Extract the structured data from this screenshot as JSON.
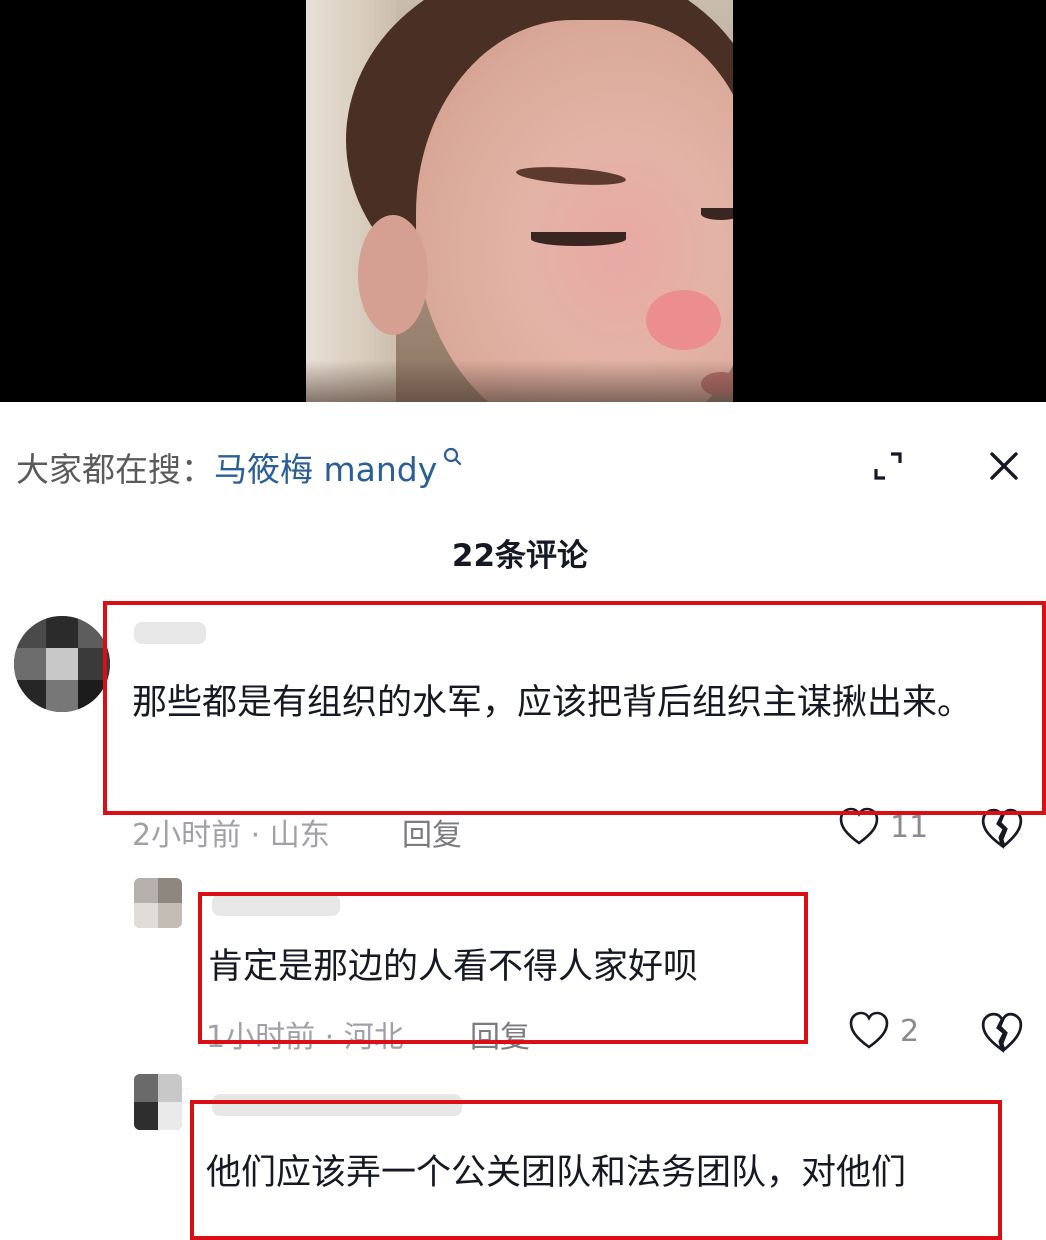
{
  "search_bar": {
    "prefix": "大家都在搜：",
    "keyword": "马筱梅 mandy"
  },
  "comments_header": {
    "count_title": "22条评论"
  },
  "comments": [
    {
      "text": "那些都是有组织的水军，应该把背后组织主谋揪出来。",
      "meta": "2小时前 · 山东",
      "reply_label": "回复",
      "likes": "11"
    },
    {
      "text": "肯定是那边的人看不得人家好呗",
      "meta": "1小时前 · 河北",
      "reply_label": "回复",
      "likes": "2"
    },
    {
      "text": "他们应该弄一个公关团队和法务团队，对他们"
    }
  ],
  "colors": {
    "keyword": "#2a5e98",
    "highlight_border": "#d90f15",
    "meta_text": "#a0a0a6"
  },
  "icons": [
    "search-icon",
    "expand-icon",
    "close-icon",
    "heart-icon",
    "broken-heart-icon"
  ]
}
